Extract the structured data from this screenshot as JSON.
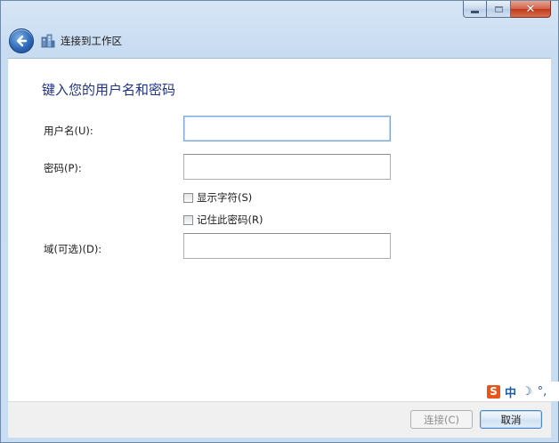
{
  "window": {
    "minimize_icon": "minimize-icon",
    "maximize_icon": "maximize-icon",
    "close_icon": "close-icon",
    "close_glyph": "✕"
  },
  "nav": {
    "back_icon": "back-arrow-icon",
    "network_icon": "network-icon",
    "title": "连接到工作区"
  },
  "form": {
    "heading": "键入您的用户名和密码",
    "username_label": "用户名(U):",
    "username_value": "",
    "password_label": "密码(P):",
    "password_value": "",
    "show_chars_label": "显示字符(S)",
    "show_chars_checked": false,
    "remember_label": "记住此密码(R)",
    "remember_checked": false,
    "domain_label": "域(可选)(D):",
    "domain_value": ""
  },
  "buttons": {
    "connect_label": "连接(C)",
    "cancel_label": "取消"
  },
  "ime": {
    "logo": "S",
    "lang": "中",
    "moon": "☽",
    "punct": "°,"
  },
  "colors": {
    "heading": "#1e3287",
    "accent": "#2b64b3",
    "close": "#c3381b"
  }
}
